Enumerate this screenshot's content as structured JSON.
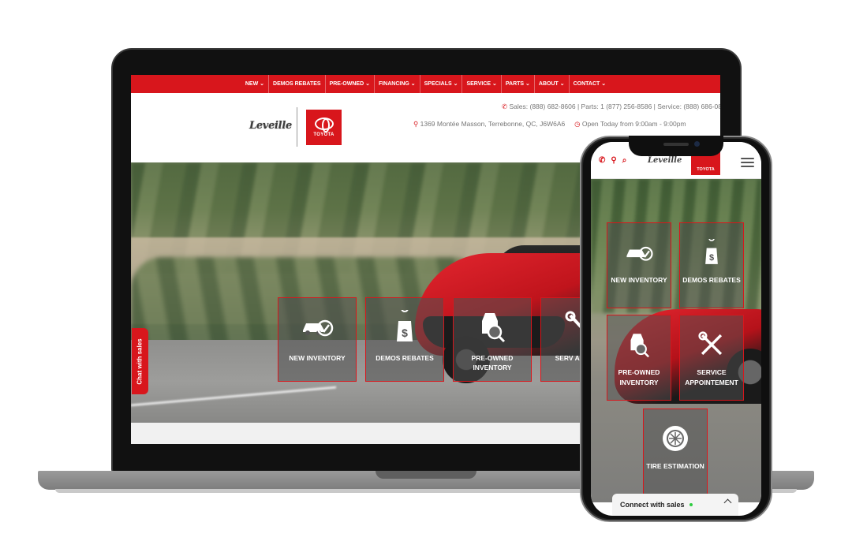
{
  "desktop": {
    "nav": [
      {
        "label": "NEW ⌄"
      },
      {
        "label": "DEMOS REBATES"
      },
      {
        "label": "PRE-OWNED ⌄"
      },
      {
        "label": "FINANCING ⌄"
      },
      {
        "label": "SPECIALS ⌄"
      },
      {
        "label": "SERVICE ⌄"
      },
      {
        "label": "PARTS ⌄"
      },
      {
        "label": "ABOUT ⌄"
      },
      {
        "label": "CONTACT ⌄"
      }
    ],
    "brand": "Leveille",
    "toyota_text": "TOYOTA",
    "contact_line": "Sales: (888) 682-8606  |  Parts: 1 (877) 256-8586  |  Service: (888) 686-08",
    "address": "1369 Montée Masson, Terrebonne, QC, J6W6A6",
    "hours": "Open Today from 9:00am - 9:00pm",
    "chat_tab": "Chat with sales",
    "tiles": [
      {
        "label": "NEW INVENTORY",
        "icon": "car-check-icon"
      },
      {
        "label": "DEMOS REBATES",
        "icon": "price-tag-icon"
      },
      {
        "label": "PRE-OWNED INVENTORY",
        "icon": "car-search-icon"
      },
      {
        "label": "SERV APPOINT",
        "icon": "wrench-icon"
      }
    ]
  },
  "mobile": {
    "brand": "Leveille",
    "toyota_text": "TOYOTA",
    "tiles": [
      {
        "label": "NEW INVENTORY",
        "icon": "car-check-icon"
      },
      {
        "label": "DEMOS REBATES",
        "icon": "price-tag-icon"
      },
      {
        "label": "PRE-OWNED INVENTORY",
        "icon": "car-search-icon"
      },
      {
        "label": "SERVICE APPOINTEMENT",
        "icon": "tools-icon"
      },
      {
        "label": "TIRE ESTIMATION",
        "icon": "tire-icon"
      }
    ],
    "connect": "Connect with sales"
  },
  "colors": {
    "brand_red": "#d8161c",
    "online_green": "#2ecc40"
  }
}
